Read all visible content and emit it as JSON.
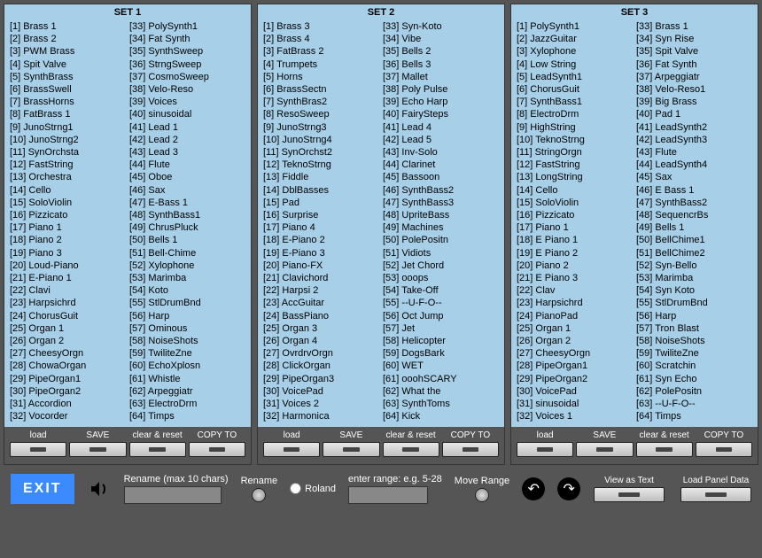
{
  "sets": [
    {
      "title": "SET 1",
      "left": [
        "Brass 1",
        "Brass 2",
        "PWM Brass",
        "Spit Valve",
        "SynthBrass",
        "BrassSwell",
        "BrassHorns",
        "FatBrass 1",
        "JunoStrng1",
        "JunoStrng2",
        "SynOrchsta",
        "FastString",
        "Orchestra",
        "Cello",
        "SoloViolin",
        "Pizzicato",
        "Piano 1",
        "Piano 2",
        "Piano 3",
        "Loud-Piano",
        "E-Piano 1",
        "Clavi",
        "Harpsichrd",
        "ChorusGuit",
        "Organ 1",
        "Organ 2",
        "CheesyOrgn",
        "ChowaOrgan",
        "PipeOrgan1",
        "PipeOrgan2",
        "Accordion",
        "Vocorder"
      ],
      "right": [
        "PolySynth1",
        "Fat Synth",
        "SynthSweep",
        "StrngSweep",
        "CosmoSweep",
        "Velo-Reso",
        " Voices",
        "sinusoidal",
        "Lead 1",
        "Lead 2",
        "Lead 3",
        "Flute",
        "Oboe",
        "Sax",
        "E-Bass 1",
        "SynthBass1",
        "ChrusPluck",
        "Bells 1",
        "Bell-Chime",
        "Xylophone",
        "Marimba",
        "Koto",
        "StlDrumBnd",
        "Harp",
        "Ominous",
        "NoiseShots",
        "TwiliteZne",
        "EchoXplosn",
        "Whistle",
        "Arpeggiatr",
        "ElectroDrm",
        "Timps"
      ]
    },
    {
      "title": "SET 2",
      "left": [
        "Brass 3",
        "Brass 4",
        "FatBrass 2",
        "Trumpets",
        "Horns",
        "BrassSectn",
        "SynthBras2",
        "ResoSweep",
        "JunoStrng3",
        "JunoStrng4",
        "SynOrchst2",
        "TeknoStrng",
        "Fiddle",
        "DblBasses",
        "Pad",
        "Surprise",
        "Piano 4",
        "E-Piano 2",
        "E-Piano 3",
        "Piano-FX",
        "Clavichord",
        "Harpsi 2",
        "AccGuitar",
        "BassPiano",
        "Organ 3",
        "Organ 4",
        "OvrdrvOrgn",
        "ClickOrgan",
        "PipeOrgan3",
        "VoicePad",
        "Voices 2",
        "Harmonica"
      ],
      "right": [
        "Syn-Koto",
        "Vibe",
        "Bells 2",
        "Bells 3",
        "Mallet",
        "Poly Pulse",
        "Echo Harp",
        "FairySteps",
        "Lead 4",
        "Lead 5",
        "Inv-Solo",
        "Clarinet",
        "Bassoon",
        "SynthBass2",
        "SynthBass3",
        "UpriteBass",
        "Machines",
        "PolePositn",
        "Vidiots",
        "Jet Chord",
        "ooops",
        "Take-Off",
        "--U-F-O--",
        "Oct Jump",
        "Jet",
        "Helicopter",
        "DogsBark",
        "WET",
        "ooohSCARY",
        "What the",
        "SynthToms",
        "Kick"
      ]
    },
    {
      "title": "SET 3",
      "left": [
        "PolySynth1",
        "JazzGuitar",
        "Xylophone",
        "Low String",
        "LeadSynth1",
        "ChorusGuit",
        "SynthBass1",
        "ElectroDrm",
        "HighString",
        "TeknoStrng",
        "StringOrgn",
        "FastString",
        "LongString",
        "Cello",
        "SoloViolin",
        "Pizzicato",
        "Piano 1",
        "E Piano 1",
        "E Piano 2",
        "Piano 2",
        "E Piano 3",
        "Clav",
        "Harpsichrd",
        "PianoPad",
        "Organ 1",
        "Organ 2",
        "CheesyOrgn",
        "PipeOrgan1",
        "PipeOrgan2",
        "VoicePad",
        "sinusoidal",
        "Voices 1"
      ],
      "right": [
        "Brass 1",
        "Syn Rise",
        "Spit Valve",
        "Fat Synth",
        "Arpeggiatr",
        "Velo-Reso1",
        "Big Brass",
        "Pad 1",
        "LeadSynth2",
        "LeadSynth3",
        "Flute",
        "LeadSynth4",
        "Sax",
        "E Bass 1",
        "SynthBass2",
        "SequencrBs",
        "Bells 1",
        "BellChime1",
        "BellChime2",
        "Syn-Bello",
        "Marimba",
        "Syn Koto",
        "StlDrumBnd",
        "Harp",
        "Tron Blast",
        "NoiseShots",
        "TwiliteZne",
        "Scratchin",
        "Syn Echo",
        "PolePositn",
        "--U-F-O--",
        "Timps"
      ]
    }
  ],
  "panelButtons": [
    "load",
    "SAVE",
    "clear & reset",
    "COPY TO"
  ],
  "bottom": {
    "exit": "EXIT",
    "renameLabel": "Rename (max 10 chars)",
    "renameBtn": "Rename",
    "roland": "Roland",
    "rangeLabel": "enter range: e.g. 5-28",
    "moveRange": "Move Range",
    "viewText": "View as Text",
    "loadPanel": "Load Panel Data"
  }
}
